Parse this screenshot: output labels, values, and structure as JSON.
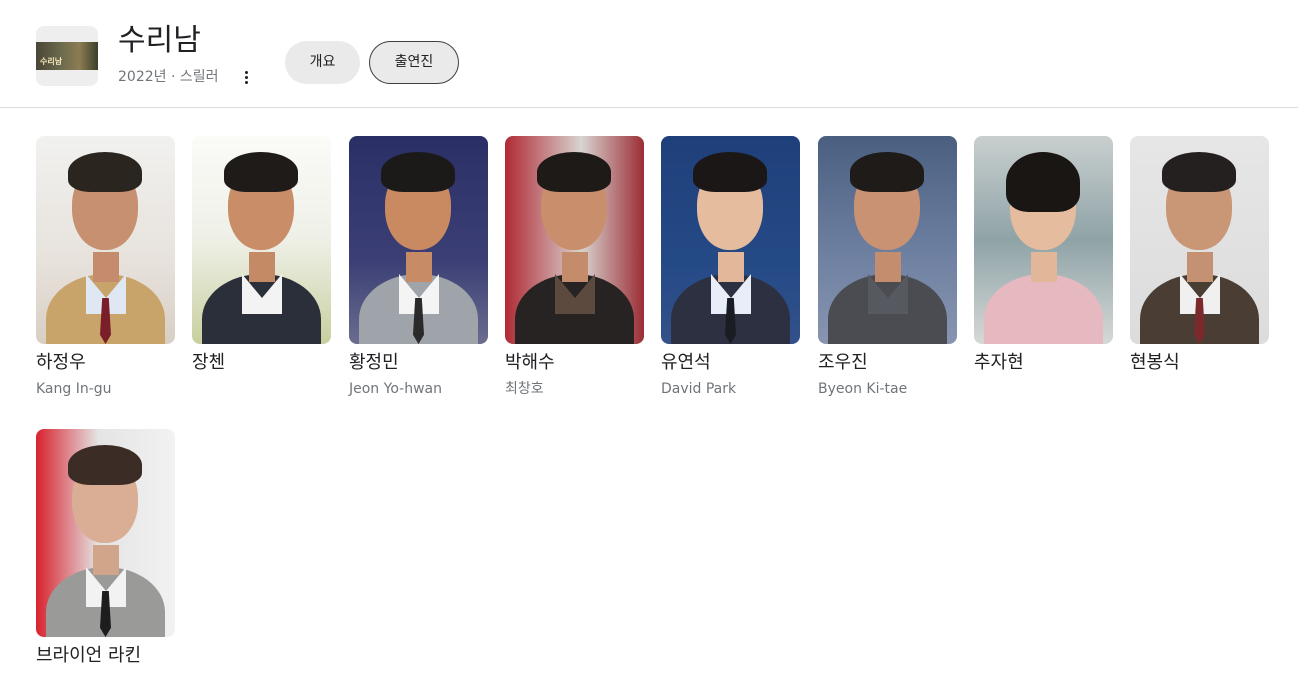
{
  "header": {
    "thumbnail_text": "수리남",
    "title": "수리남",
    "subtitle": "2022년 · 스릴러",
    "more_icon": "more-vert-icon"
  },
  "tabs": [
    {
      "label": "개요",
      "selected": false
    },
    {
      "label": "출연진",
      "selected": true
    }
  ],
  "cast": [
    {
      "name": "하정우",
      "role": "Kang In-gu"
    },
    {
      "name": "장첸",
      "role": ""
    },
    {
      "name": "황정민",
      "role": "Jeon Yo-hwan"
    },
    {
      "name": "박해수",
      "role": "최창호"
    },
    {
      "name": "유연석",
      "role": "David Park"
    },
    {
      "name": "조우진",
      "role": "Byeon Ki-tae"
    },
    {
      "name": "추자현",
      "role": ""
    },
    {
      "name": "현봉식",
      "role": ""
    },
    {
      "name": "브라이언 라킨",
      "role": ""
    }
  ],
  "colors": {
    "tab_bg": "#eaeaea",
    "tab_selected_border": "#3c4043",
    "secondary_text": "#70757a"
  }
}
